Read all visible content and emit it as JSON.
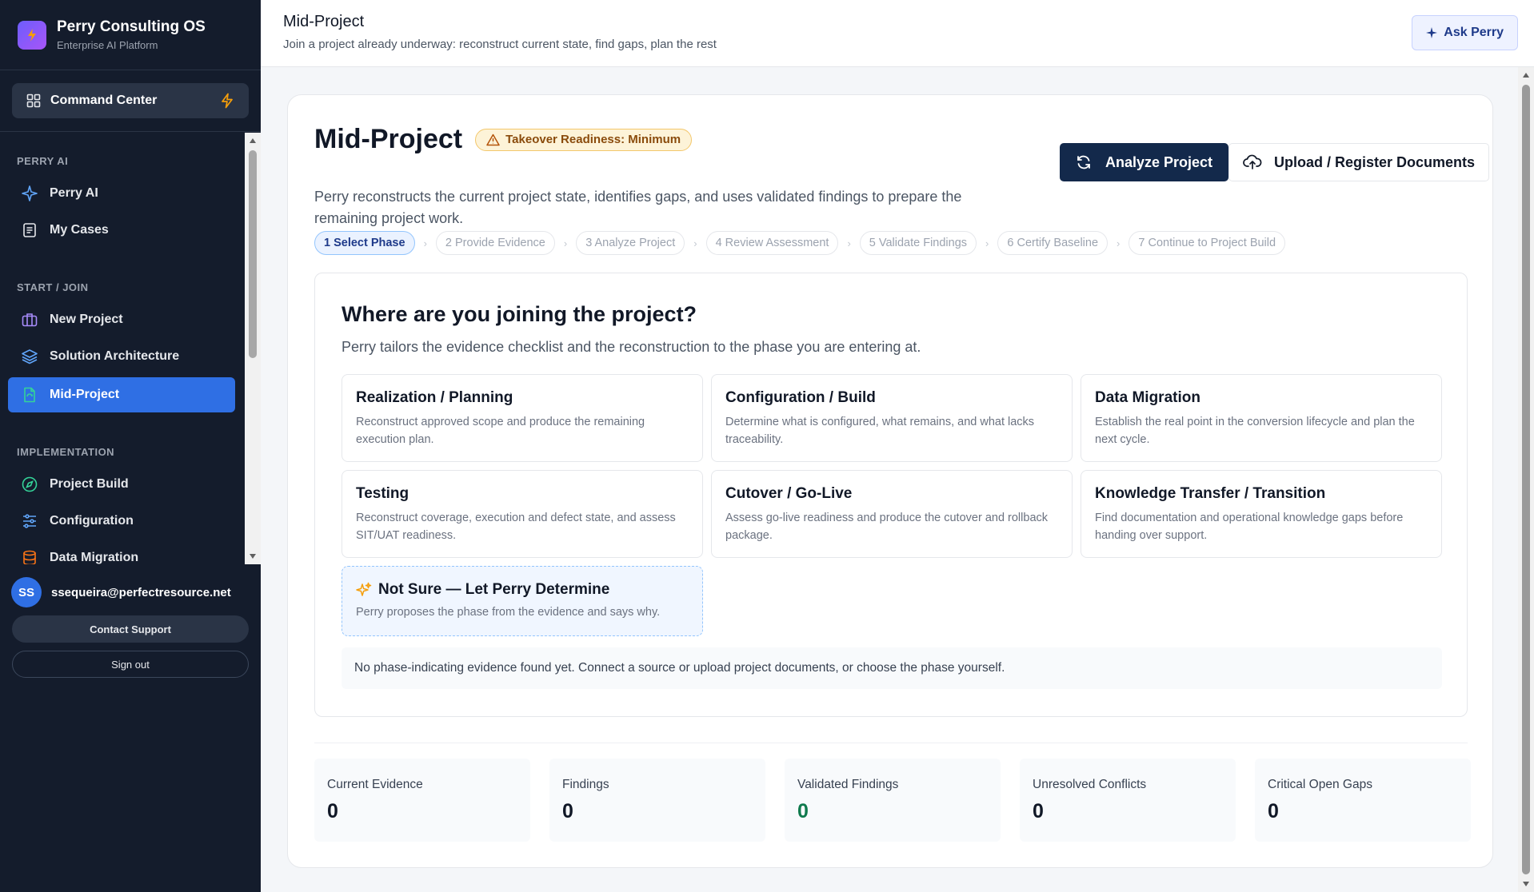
{
  "brand": {
    "title": "Perry Consulting OS",
    "subtitle": "Enterprise AI Platform"
  },
  "command_center": {
    "label": "Command Center"
  },
  "nav": {
    "sections": [
      {
        "label": "PERRY AI",
        "items": [
          {
            "label": "Perry AI",
            "icon": "sparkle-icon"
          },
          {
            "label": "My Cases",
            "icon": "document-icon"
          }
        ]
      },
      {
        "label": "START / JOIN",
        "items": [
          {
            "label": "New Project",
            "icon": "briefcase-icon"
          },
          {
            "label": "Solution Architecture",
            "icon": "layers-icon"
          },
          {
            "label": "Mid-Project",
            "icon": "file-refresh-icon",
            "active": true
          }
        ]
      },
      {
        "label": "IMPLEMENTATION",
        "items": [
          {
            "label": "Project Build",
            "icon": "compass-icon"
          },
          {
            "label": "Configuration",
            "icon": "sliders-icon"
          },
          {
            "label": "Data Migration",
            "icon": "database-icon"
          }
        ]
      }
    ]
  },
  "user": {
    "initials": "SS",
    "email": "ssequeira@perfectresource.net"
  },
  "footer": {
    "support_label": "Contact Support",
    "signout_label": "Sign out"
  },
  "topbar": {
    "title": "Mid-Project",
    "subtitle": "Join a project already underway: reconstruct current state, find gaps, plan the rest",
    "ask_label": "Ask Perry"
  },
  "page": {
    "title": "Mid-Project",
    "badge": "Takeover Readiness: Minimum",
    "description": "Perry reconstructs the current project state, identifies gaps, and uses validated findings to prepare the remaining project work.",
    "analyze_label": "Analyze Project",
    "upload_label": "Upload / Register Documents",
    "steps": [
      "1 Select Phase",
      "2 Provide Evidence",
      "3 Analyze Project",
      "4 Review Assessment",
      "5 Validate Findings",
      "6 Certify Baseline",
      "7 Continue to Project Build"
    ],
    "active_step": 0
  },
  "phase_select": {
    "title": "Where are you joining the project?",
    "lead": "Perry tailors the evidence checklist and the reconstruction to the phase you are entering at.",
    "phases": [
      {
        "title": "Realization / Planning",
        "desc": "Reconstruct approved scope and produce the remaining execution plan."
      },
      {
        "title": "Configuration / Build",
        "desc": "Determine what is configured, what remains, and what lacks traceability."
      },
      {
        "title": "Data Migration",
        "desc": "Establish the real point in the conversion lifecycle and plan the next cycle."
      },
      {
        "title": "Testing",
        "desc": "Reconstruct coverage, execution and defect state, and assess SIT/UAT readiness."
      },
      {
        "title": "Cutover / Go-Live",
        "desc": "Assess go-live readiness and produce the cutover and rollback package."
      },
      {
        "title": "Knowledge Transfer / Transition",
        "desc": "Find documentation and operational knowledge gaps before handing over support."
      }
    ],
    "unsure": {
      "title": "Not Sure — Let Perry Determine",
      "desc": "Perry proposes the phase from the evidence and says why."
    },
    "notice": "No phase-indicating evidence found yet. Connect a source or upload project documents, or choose the phase yourself."
  },
  "stats": [
    {
      "label": "Current Evidence",
      "value": "0"
    },
    {
      "label": "Findings",
      "value": "0"
    },
    {
      "label": "Validated Findings",
      "value": "0",
      "color": "#0f7a4d"
    },
    {
      "label": "Unresolved Conflicts",
      "value": "0"
    },
    {
      "label": "Critical Open Gaps",
      "value": "0"
    }
  ],
  "colors": {
    "sidebar_bg": "#141c2c",
    "accent": "#2f6fe4",
    "primary_button": "#13294b",
    "warning": "#f3c76b"
  }
}
